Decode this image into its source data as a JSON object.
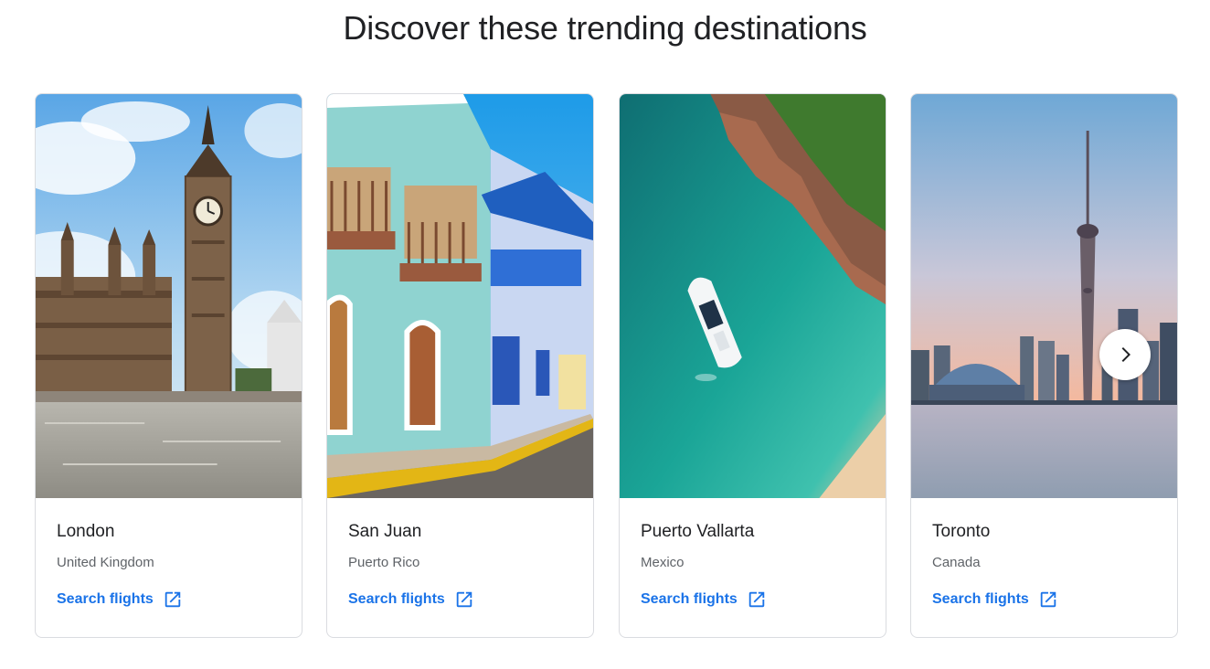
{
  "heading": "Discover these trending destinations",
  "destinations": [
    {
      "city": "London",
      "country": "United Kingdom",
      "cta": "Search flights"
    },
    {
      "city": "San Juan",
      "country": "Puerto Rico",
      "cta": "Search flights"
    },
    {
      "city": "Puerto Vallarta",
      "country": "Mexico",
      "cta": "Search flights"
    },
    {
      "city": "Toronto",
      "country": "Canada",
      "cta": "Search flights"
    }
  ],
  "icons": {
    "external_link": "external-link-icon",
    "next": "chevron-right-icon"
  },
  "colors": {
    "link": "#1a73e8",
    "title": "#202124",
    "subtitle": "#5f6368",
    "border": "#dadce0"
  }
}
